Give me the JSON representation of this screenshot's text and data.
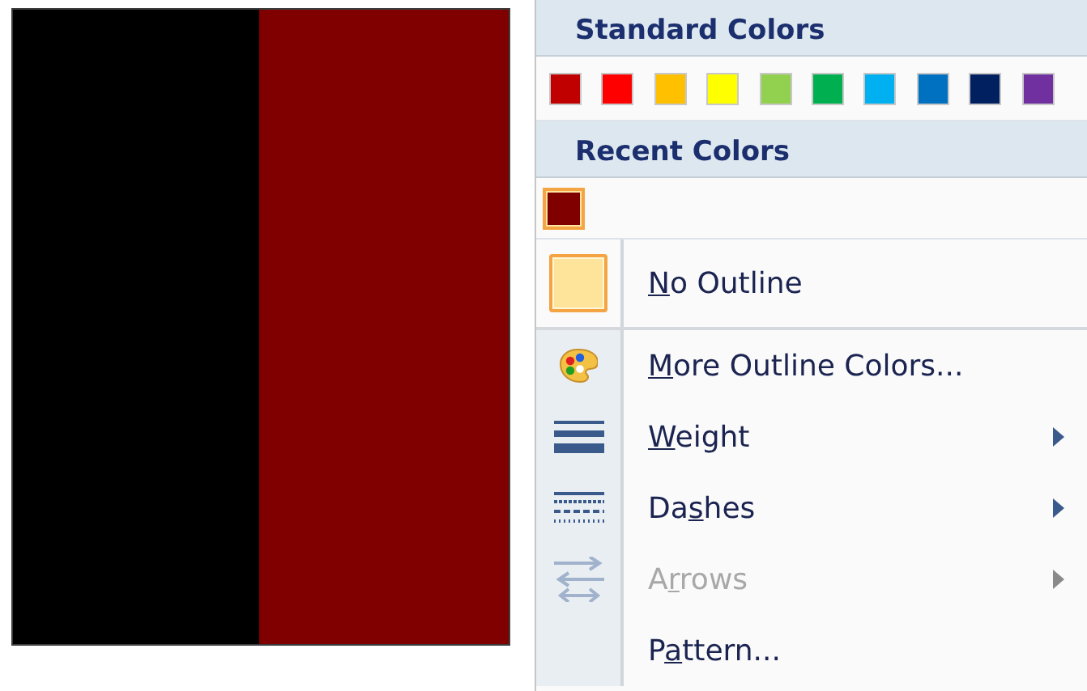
{
  "canvas": {
    "shapes": [
      {
        "color": "#000000"
      },
      {
        "color": "#800000"
      }
    ]
  },
  "menu": {
    "standard_colors": {
      "title": "Standard Colors",
      "swatches": [
        {
          "color": "#c00000",
          "selected": false
        },
        {
          "color": "#ff0000",
          "selected": false
        },
        {
          "color": "#ffc000",
          "selected": false
        },
        {
          "color": "#ffff00",
          "selected": false
        },
        {
          "color": "#92d050",
          "selected": false
        },
        {
          "color": "#00b050",
          "selected": false
        },
        {
          "color": "#00b0f0",
          "selected": false
        },
        {
          "color": "#0070c0",
          "selected": false
        },
        {
          "color": "#002060",
          "selected": false
        },
        {
          "color": "#7030a0",
          "selected": false
        }
      ]
    },
    "recent_colors": {
      "title": "Recent Colors",
      "swatches": [
        {
          "color": "#800000",
          "selected": true
        }
      ]
    },
    "no_outline": {
      "access_key": "N",
      "label_after": "o Outline"
    },
    "items": [
      {
        "kind": "palette",
        "access_key": "M",
        "label_after": "ore Outline Colors...",
        "submenu": false,
        "disabled": false
      },
      {
        "kind": "weight",
        "access_key": "W",
        "label_after": "eight",
        "submenu": true,
        "disabled": false
      },
      {
        "kind": "dashes",
        "label_before": "Da",
        "access_key": "s",
        "label_after": "hes",
        "submenu": true,
        "disabled": false
      },
      {
        "kind": "arrows",
        "label_before": "A",
        "access_key": "r",
        "label_after": "rows",
        "submenu": true,
        "disabled": true
      },
      {
        "kind": "none",
        "label_before": "P",
        "access_key": "a",
        "label_after": "ttern...",
        "submenu": false,
        "disabled": false
      }
    ]
  }
}
